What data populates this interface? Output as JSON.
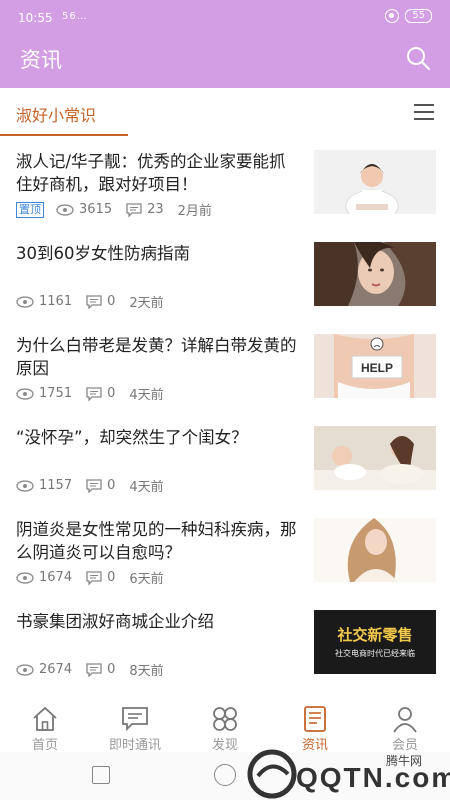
{
  "status_bar": {
    "time": "10:55",
    "signal": "56…",
    "battery": "55"
  },
  "header": {
    "title": "资讯",
    "search_icon": "search-icon"
  },
  "tabbar": {
    "active_tab": "淑好小常识",
    "menu_icon": "menu-icon"
  },
  "articles": [
    {
      "title": "淑人记/华子靓：优秀的企业家要能抓住好商机，跟对好项目！",
      "badge": "置顶",
      "views": "3615",
      "comments": "23",
      "time": "2月前"
    },
    {
      "title": "30到60岁女性防病指南",
      "badge": "",
      "views": "1161",
      "comments": "0",
      "time": "2天前"
    },
    {
      "title": "为什么白带老是发黄？详解白带发黄的原因",
      "badge": "",
      "views": "1751",
      "comments": "0",
      "time": "4天前"
    },
    {
      "title": "“没怀孕”，却突然生了个闺女？",
      "badge": "",
      "views": "1157",
      "comments": "0",
      "time": "4天前"
    },
    {
      "title": "阴道炎是女性常见的一种妇科疾病，那么阴道炎可以自愈吗？",
      "badge": "",
      "views": "1674",
      "comments": "0",
      "time": "6天前"
    },
    {
      "title": "书豪集团淑好商城企业介绍",
      "badge": "",
      "views": "2674",
      "comments": "0",
      "time": "8天前"
    }
  ],
  "thumb_texts": {
    "help": "HELP",
    "promo_main": "社交新零售",
    "promo_sub": "社交电商时代已经来临"
  },
  "bottom_nav": [
    {
      "label": "首页",
      "icon": "home-icon"
    },
    {
      "label": "即时通讯",
      "icon": "chat-icon"
    },
    {
      "label": "发现",
      "icon": "discover-icon"
    },
    {
      "label": "资讯",
      "icon": "news-icon"
    },
    {
      "label": "会员",
      "icon": "user-icon"
    }
  ],
  "watermark": {
    "site": "QQTN.com",
    "small": "腾牛网"
  },
  "colors": {
    "header": "#d49ee4",
    "accent": "#c6632a",
    "badge": "#3d86d8"
  }
}
